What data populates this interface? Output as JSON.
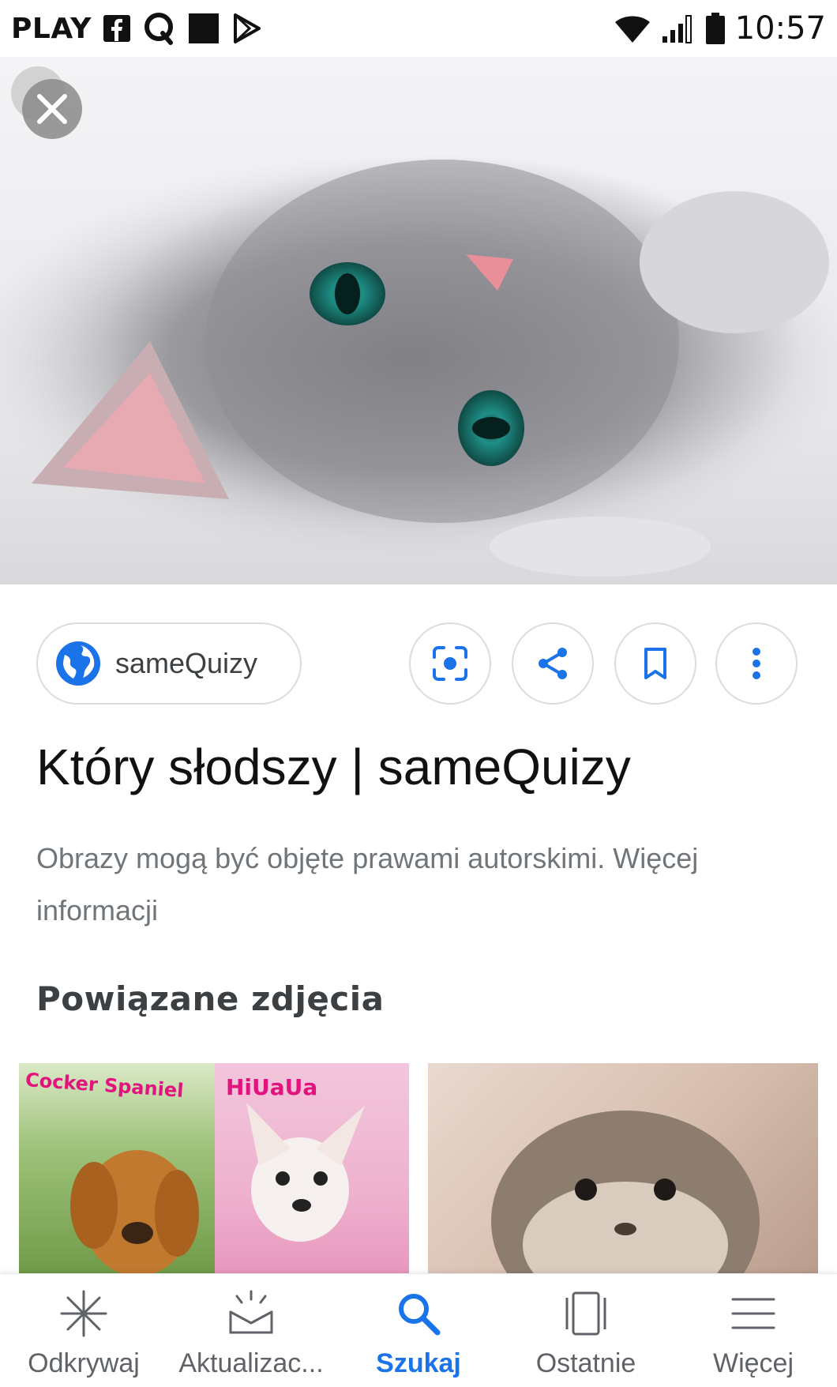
{
  "status_bar": {
    "carrier": "PLAY",
    "time": "10:57",
    "icons": [
      "facebook-icon",
      "quora-icon",
      "app-square-icon",
      "play-store-icon",
      "wifi-icon",
      "signal-icon",
      "battery-icon"
    ]
  },
  "hero": {
    "close_icon": "close-icon"
  },
  "source": {
    "site_name": "sameQuizy",
    "site_icon": "globe-icon"
  },
  "actions": {
    "lens_icon": "lens-icon",
    "share_icon": "share-icon",
    "save_icon": "bookmark-icon",
    "more_icon": "more-vert-icon"
  },
  "result": {
    "title": "Który słodszy | sameQuizy",
    "copyright": "Obrazy mogą być objęte prawami autorskimi. Więcej informacji"
  },
  "related": {
    "heading": "Powiązane zdjęcia",
    "items": [
      {
        "left_label": "Cocker Spaniel",
        "right_label": "HiUaUa"
      },
      {
        "label": ""
      }
    ]
  },
  "bottom_nav": {
    "items": [
      {
        "label": "Odkrywaj",
        "icon": "discover-icon"
      },
      {
        "label": "Aktualizac...",
        "icon": "updates-icon"
      },
      {
        "label": "Szukaj",
        "icon": "search-icon"
      },
      {
        "label": "Ostatnie",
        "icon": "recent-icon"
      },
      {
        "label": "Więcej",
        "icon": "menu-icon"
      }
    ],
    "active_color": "#1a73e8",
    "inactive_color": "#5f6368"
  },
  "colors": {
    "accent": "#1a73e8",
    "chip_border": "#dadce0",
    "secondary_text": "#70757a"
  }
}
